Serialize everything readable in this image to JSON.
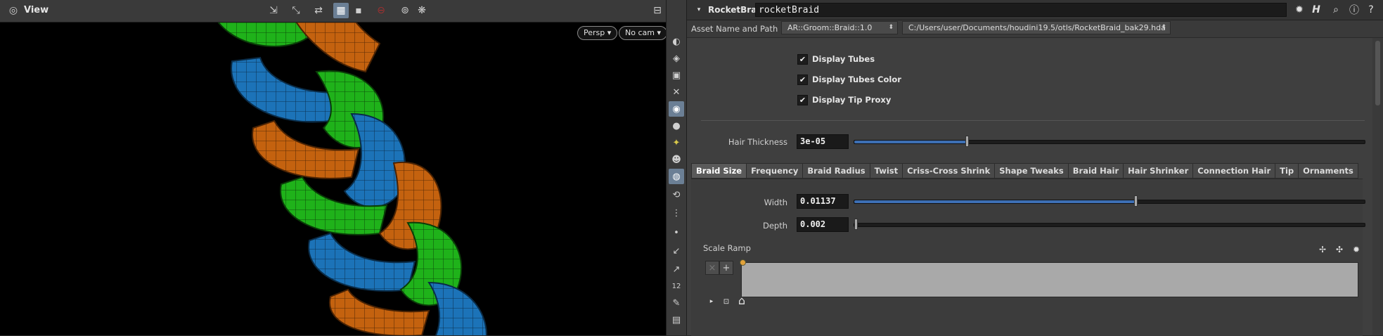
{
  "viewport": {
    "title": "View",
    "persp_label": "Persp",
    "camera_label": "No cam",
    "dropdown_glyph": "▾",
    "toolbar_icons": [
      "select-icon",
      "transform-icon",
      "handle-icon",
      "display-options-icon",
      "shading-icon",
      "record-icon",
      "camera-icon",
      "snap-icon",
      "layout-icon",
      "help-icon"
    ],
    "side_icons": [
      "view-icon",
      "visibility-icon",
      "lock-icon",
      "ghost-icon",
      "wireframe-icon",
      "light-icon",
      "headlight-icon",
      "user-icon",
      "shaded-icon",
      "guide-icon",
      "particles-icon",
      "point-icon",
      "vector-icon",
      "normal-icon",
      "number-icon",
      "brush-icon",
      "texture-icon"
    ]
  },
  "param_pane": {
    "node_type": "RocketBraid",
    "node_name": "rocketBraid",
    "asset": {
      "label": "Asset Name and Path",
      "name": "AR::Groom::Braid::1.0",
      "path": "C:/Users/user/Documents/houdini19.5/otls/RocketBraid_bak29.hda",
      "arrow_glyph": "⬍"
    },
    "checkboxes": [
      {
        "label": "Display Tubes",
        "checked": true
      },
      {
        "label": "Display Tubes Color",
        "checked": true
      },
      {
        "label": "Display Tip Proxy",
        "checked": true
      }
    ],
    "checkmark_glyph": "✔",
    "hair_thickness": {
      "label": "Hair Thickness",
      "value": "3e-05",
      "fraction": 0.22
    },
    "tabs": [
      "Braid Size",
      "Frequency",
      "Braid Radius",
      "Twist",
      "Criss-Cross Shrink",
      "Shape Tweaks",
      "Braid Hair",
      "Hair Shrinker",
      "Connection Hair",
      "Tip",
      "Ornaments"
    ],
    "active_tab": "Braid Size",
    "width": {
      "label": "Width",
      "value": "0.01137",
      "fraction": 0.55
    },
    "depth": {
      "label": "Depth",
      "value": "0.002",
      "fraction": 0.0
    },
    "scale_ramp": {
      "label": "Scale Ramp",
      "remove_glyph": "×",
      "add_glyph": "+"
    },
    "header_icons": [
      "gear-icon",
      "houdini-icon",
      "search-icon",
      "info-icon",
      "help-icon"
    ]
  },
  "colors": {
    "accent": "#3d6fb4",
    "braid_green": "#1fb21a",
    "braid_blue": "#1c73b8",
    "braid_orange": "#c4620f"
  }
}
